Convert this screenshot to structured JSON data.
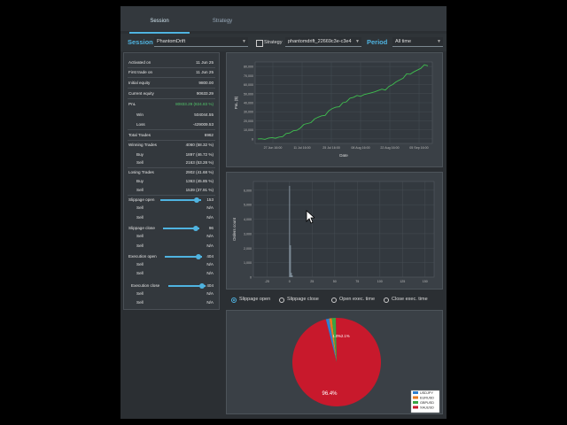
{
  "tabs": [
    {
      "label": "Session"
    },
    {
      "label": "Strategy"
    }
  ],
  "toolbar": {
    "session_label": "Session",
    "session_value": "PhantomDrift",
    "strategy_checkbox_label": "Strategy",
    "strategy_value": "phantomdrift_22669c3e-c3e4",
    "period_label": "Period",
    "period_value": "All time"
  },
  "stats": {
    "activated_on": {
      "label": "Activated on",
      "value": "11 Jun 25"
    },
    "first_trade_on": {
      "label": "First trade on",
      "value": "11 Jun 25"
    },
    "initial_equity": {
      "label": "Initial equity",
      "value": "9800.00"
    },
    "current_equity": {
      "label": "Current equity",
      "value": "90633.29"
    },
    "pnl": {
      "label": "PnL",
      "value": "80833.29 (824.83 %)"
    },
    "win": {
      "label": "Win",
      "value": "504044.55"
    },
    "loss": {
      "label": "Loss",
      "value": "-429009.53"
    },
    "total_trades": {
      "label": "Total Trades",
      "value": "6962"
    },
    "winning_trades": {
      "label": "Winning Trades",
      "value": "4060 (58.32 %)"
    },
    "winning_buy": {
      "label": "Buy",
      "value": "1897 (46.72 %)"
    },
    "winning_sell": {
      "label": "Sell",
      "value": "2163 (53.28 %)"
    },
    "losing_trades": {
      "label": "Losing Trades",
      "value": "2902 (41.68 %)"
    },
    "losing_buy": {
      "label": "Buy",
      "value": "1363 (45.85 %)"
    },
    "losing_sell": {
      "label": "Sell",
      "value": "1539 (37.91 %)"
    }
  },
  "sliders": {
    "slippage_open": {
      "label": "Slippage open",
      "value": "153",
      "level": 0.9,
      "sell": {
        "label": "Sell",
        "value": "N/A"
      },
      "buy": {
        "label": "Sell",
        "value": "N/A"
      }
    },
    "slippage_close": {
      "label": "Slippage close",
      "value": "96",
      "level": 0.9,
      "sell": {
        "label": "Sell",
        "value": "N/A"
      },
      "buy": {
        "label": "Sell",
        "value": "N/A"
      }
    },
    "execution_open": {
      "label": "Execution open",
      "value": "404",
      "level": 0.9,
      "sell": {
        "label": "Sell",
        "value": "N/A"
      },
      "buy": {
        "label": "Sell",
        "value": "N/A"
      }
    },
    "execution_close": {
      "label": "Execution close",
      "value": "404",
      "level": 0.9,
      "sell": {
        "label": "Sell",
        "value": "N/A"
      },
      "buy": {
        "label": "Sell",
        "value": "N/A"
      }
    }
  },
  "radio_options": [
    {
      "label": "Slippage open",
      "selected": true
    },
    {
      "label": "Slippage close",
      "selected": false
    },
    {
      "label": "Open exec. time",
      "selected": false
    },
    {
      "label": "Close exec. time",
      "selected": false
    }
  ],
  "colors": {
    "accent": "#4fb3e0",
    "line": "#3fbf4f",
    "pie_main": "#c8192c"
  },
  "chart_data": [
    {
      "type": "line",
      "xlabel": "Date",
      "ylabel": "PnL ($)",
      "x_ticks": [
        "27 Jun 16:00",
        "11 Jul 16:00",
        "25 Jul 16:00",
        "08 Aug 16:00",
        "22 Aug 16:00",
        "05 Sep 16:00"
      ],
      "y_ticks": [
        "0",
        "10,000",
        "20,000",
        "30,000",
        "40,000",
        "50,000",
        "60,000",
        "70,000",
        "80,000"
      ],
      "ylim": [
        -5000,
        85000
      ],
      "values": [
        0,
        200,
        -500,
        1000,
        1500,
        800,
        2000,
        2500,
        6000,
        6500,
        9000,
        9500,
        12000,
        16000,
        17000,
        18000,
        22000,
        24000,
        25500,
        26000,
        31000,
        33500,
        35000,
        35500,
        40000,
        41000,
        45000,
        46000,
        48000,
        47000,
        49000,
        50000,
        51000,
        52000,
        53500,
        55000,
        54000,
        58000,
        60000,
        63000,
        65000,
        67000,
        72000,
        71500,
        74000,
        76000,
        78000,
        82000,
        80833
      ]
    },
    {
      "type": "bar",
      "ylabel": "Orders count",
      "x_ticks": [
        "-25",
        "0",
        "25",
        "50",
        "75",
        "100",
        "125",
        "150"
      ],
      "y_ticks": [
        "0",
        "1,000",
        "2,000",
        "3,000",
        "4,000",
        "5,000",
        "6,000"
      ],
      "xlim": [
        -40,
        160
      ],
      "ylim": [
        0,
        6600
      ],
      "bins": [
        {
          "x": 0,
          "count": 6300
        },
        {
          "x": 1,
          "count": 2200
        },
        {
          "x": 2,
          "count": 300
        },
        {
          "x": 3,
          "count": 120
        }
      ]
    },
    {
      "type": "pie",
      "series": [
        {
          "name": "USDJPY",
          "value": 1.2,
          "color": "#2f7fd0"
        },
        {
          "name": "EURUSD",
          "value": 1.0,
          "color": "#e87a20"
        },
        {
          "name": "GBPUSD",
          "value": 1.4,
          "color": "#38a544"
        },
        {
          "name": "XAUUSD",
          "value": 96.4,
          "color": "#c8192c"
        }
      ],
      "data_labels": {
        "main": "96.4%",
        "small": "1.0%2.1%"
      }
    }
  ]
}
